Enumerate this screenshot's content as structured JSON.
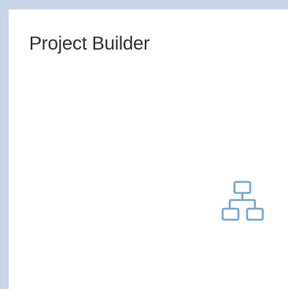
{
  "tile": {
    "title": "Project Builder",
    "icon": "hierarchy-icon",
    "colors": {
      "frame": "#c9d6e6",
      "background": "#ffffff",
      "title_text": "#333333",
      "icon": "#7aa8d8"
    }
  }
}
